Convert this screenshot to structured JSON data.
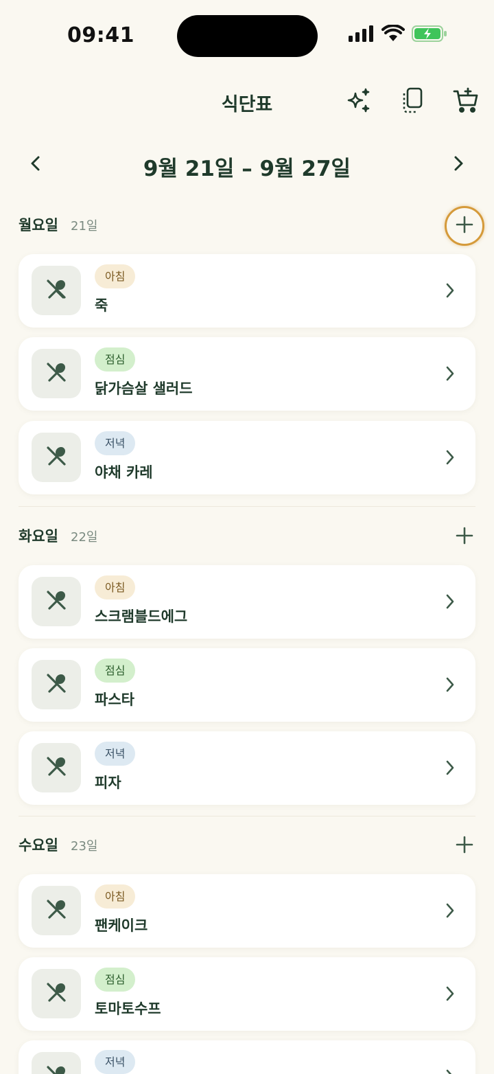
{
  "status": {
    "time": "09:41"
  },
  "nav": {
    "title": "식단표",
    "icons": [
      "sparkles-icon",
      "copy-icon",
      "cart-add-icon"
    ]
  },
  "week": {
    "title": "9월 21일 – 9월 27일",
    "prev_icon": "chevron-left-icon",
    "next_icon": "chevron-right-icon"
  },
  "days": [
    {
      "name": "월요일",
      "date": "21일",
      "meals": [
        {
          "type": "아침",
          "name": "죽"
        },
        {
          "type": "점심",
          "name": "닭가슴살 샐러드"
        },
        {
          "type": "저녁",
          "name": "야채 카레"
        }
      ]
    },
    {
      "name": "화요일",
      "date": "22일",
      "meals": [
        {
          "type": "아침",
          "name": "스크램블드에그"
        },
        {
          "type": "점심",
          "name": "파스타"
        },
        {
          "type": "저녁",
          "name": "피자"
        }
      ]
    },
    {
      "name": "수요일",
      "date": "23일",
      "meals": [
        {
          "type": "아침",
          "name": "팬케이크"
        },
        {
          "type": "점심",
          "name": "토마토수프"
        },
        {
          "type": "저녁",
          "name": ""
        }
      ]
    }
  ],
  "colors": {
    "background": "#faf8f1",
    "text": "#1f3a2b",
    "breakfast_tag": "#f7ecd6",
    "lunch_tag": "#d3efcc",
    "dinner_tag": "#dde9f2",
    "highlight": "#d59a3a"
  }
}
